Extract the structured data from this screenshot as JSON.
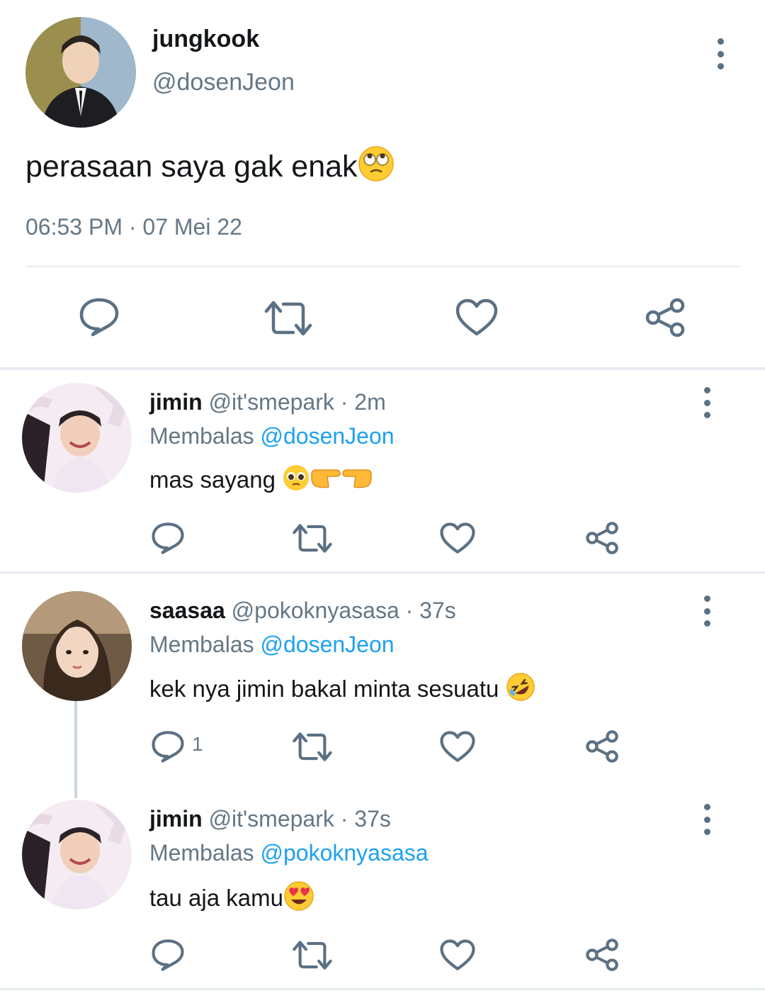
{
  "main_tweet": {
    "display_name": "jungkook",
    "handle": "@dosenJeon",
    "text": "perasaan saya gak enak",
    "emoji": "eye-roll-emoji",
    "timestamp": "06:53 PM · 07 Mei 22"
  },
  "replies": [
    {
      "display_name": "jimin",
      "handle": "@it'smepark",
      "time": "· 2m",
      "replying_prefix": "Membalas",
      "replying_to": "@dosenJeon",
      "text": "mas sayang ",
      "emojis": [
        "pleading-face-emoji",
        "pointing-right-emoji",
        "pointing-left-emoji"
      ],
      "reply_count": ""
    },
    {
      "display_name": "saasaa",
      "handle": "@pokoknyasasa",
      "time": "· 37s",
      "replying_prefix": "Membalas",
      "replying_to": "@dosenJeon",
      "text": "kek nya jimin bakal minta sesuatu ",
      "emojis": [
        "rolling-laughing-emoji"
      ],
      "reply_count": "1"
    },
    {
      "display_name": "jimin",
      "handle": "@it'smepark",
      "time": "· 37s",
      "replying_prefix": "Membalas",
      "replying_to": "@pokoknyasasa",
      "text": "tau aja kamu",
      "emojis": [
        "heart-eyes-emoji"
      ],
      "reply_count": ""
    }
  ],
  "icons": {
    "reply": "reply-icon",
    "retweet": "retweet-icon",
    "like": "like-icon",
    "share": "share-icon",
    "more": "more-options-icon"
  },
  "colors": {
    "icon": "#5b7083",
    "link": "#1da1f2",
    "muted": "#657786",
    "divider": "#e6ecf0"
  }
}
